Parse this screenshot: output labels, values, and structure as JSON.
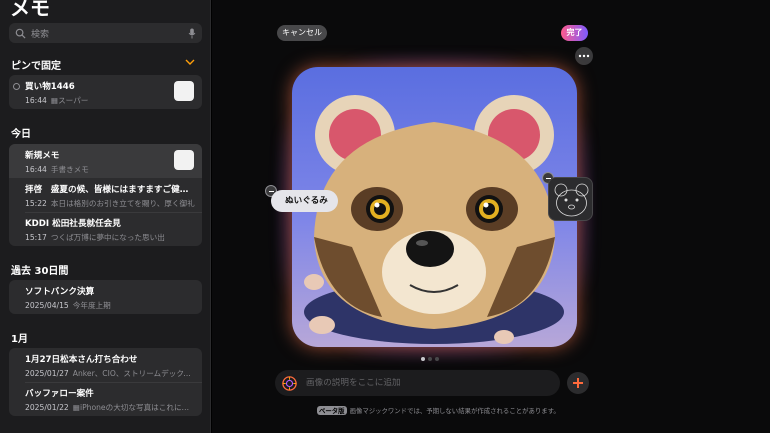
{
  "sidebar": {
    "title": "メモ",
    "search_placeholder": "検索",
    "pinned_title": "ピンで固定",
    "pinned": [
      {
        "title": "買い物1446",
        "time": "16:44",
        "preview": "スーパー"
      }
    ],
    "today_title": "今日",
    "today": [
      {
        "title": "新規メモ",
        "time": "16:44",
        "preview": "手書きメモ"
      },
      {
        "title": "拝啓　盛夏の候、皆様にはますますご健勝のこととお喜び申し上げます",
        "time": "15:22",
        "preview": "本日は格別のお引き立てを賜り、厚く御礼"
      },
      {
        "title": "KDDI 松田社長就任会見",
        "time": "15:17",
        "preview": "つくば万博に夢中になった思い出"
      }
    ],
    "last30_title": "過去 30日間",
    "last30": [
      {
        "title": "ソフトバンク決算",
        "time": "2025/04/15",
        "preview": "今年度上期"
      }
    ],
    "jan_title": "1月",
    "jan": [
      {
        "title": "1月27日松本さん打ち合わせ",
        "time": "2025/01/27",
        "preview": "Anker、CIO、ストリームデック、エレコム"
      },
      {
        "title": "バッファロー案件",
        "time": "2025/01/22",
        "preview": "iPhoneの大切な写真はこれに保存"
      }
    ]
  },
  "editor": {
    "cancel_label": "キャンセル",
    "done_label": "完了",
    "chip_label": "ぬいぐるみ",
    "description_placeholder": "画像の説明をここに追加",
    "beta_label": "ベータ版",
    "footer_text": "画像マジックワンドでは、予期しない結果が作成されることがあります。",
    "page_dots": 3,
    "active_dot": 0
  },
  "colors": {
    "accent_orange": "#ff6b3d",
    "done_gradient_start": "#ff5b8d",
    "done_gradient_end": "#7d5bff"
  }
}
